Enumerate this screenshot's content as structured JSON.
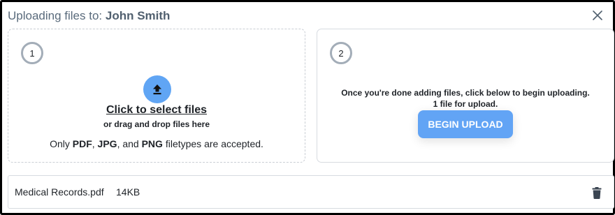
{
  "header": {
    "title_prefix": "Uploading files to:",
    "recipient": "John Smith",
    "close_icon": "close-icon"
  },
  "step1": {
    "number": "1",
    "upload_icon": "upload-arrow-icon",
    "select_link": "Click to select files",
    "drag_hint": "or drag and drop files here",
    "types": {
      "prefix": "Only",
      "pdf": "PDF",
      "sep1": ",",
      "jpg": "JPG",
      "sep2": ", and",
      "png": "PNG",
      "suffix": "filetypes are accepted."
    }
  },
  "step2": {
    "number": "2",
    "instructions": "Once you're done adding files, click below to begin uploading.",
    "count_text": "1 file for upload.",
    "begin_label": "BEGIN UPLOAD"
  },
  "files": [
    {
      "name": "Medical Records.pdf",
      "size": "14KB",
      "delete_icon": "trash-icon"
    }
  ],
  "colors": {
    "accent": "#62a4f5",
    "title_gray": "#5a6b7c",
    "step_ring": "#a3adb8"
  }
}
